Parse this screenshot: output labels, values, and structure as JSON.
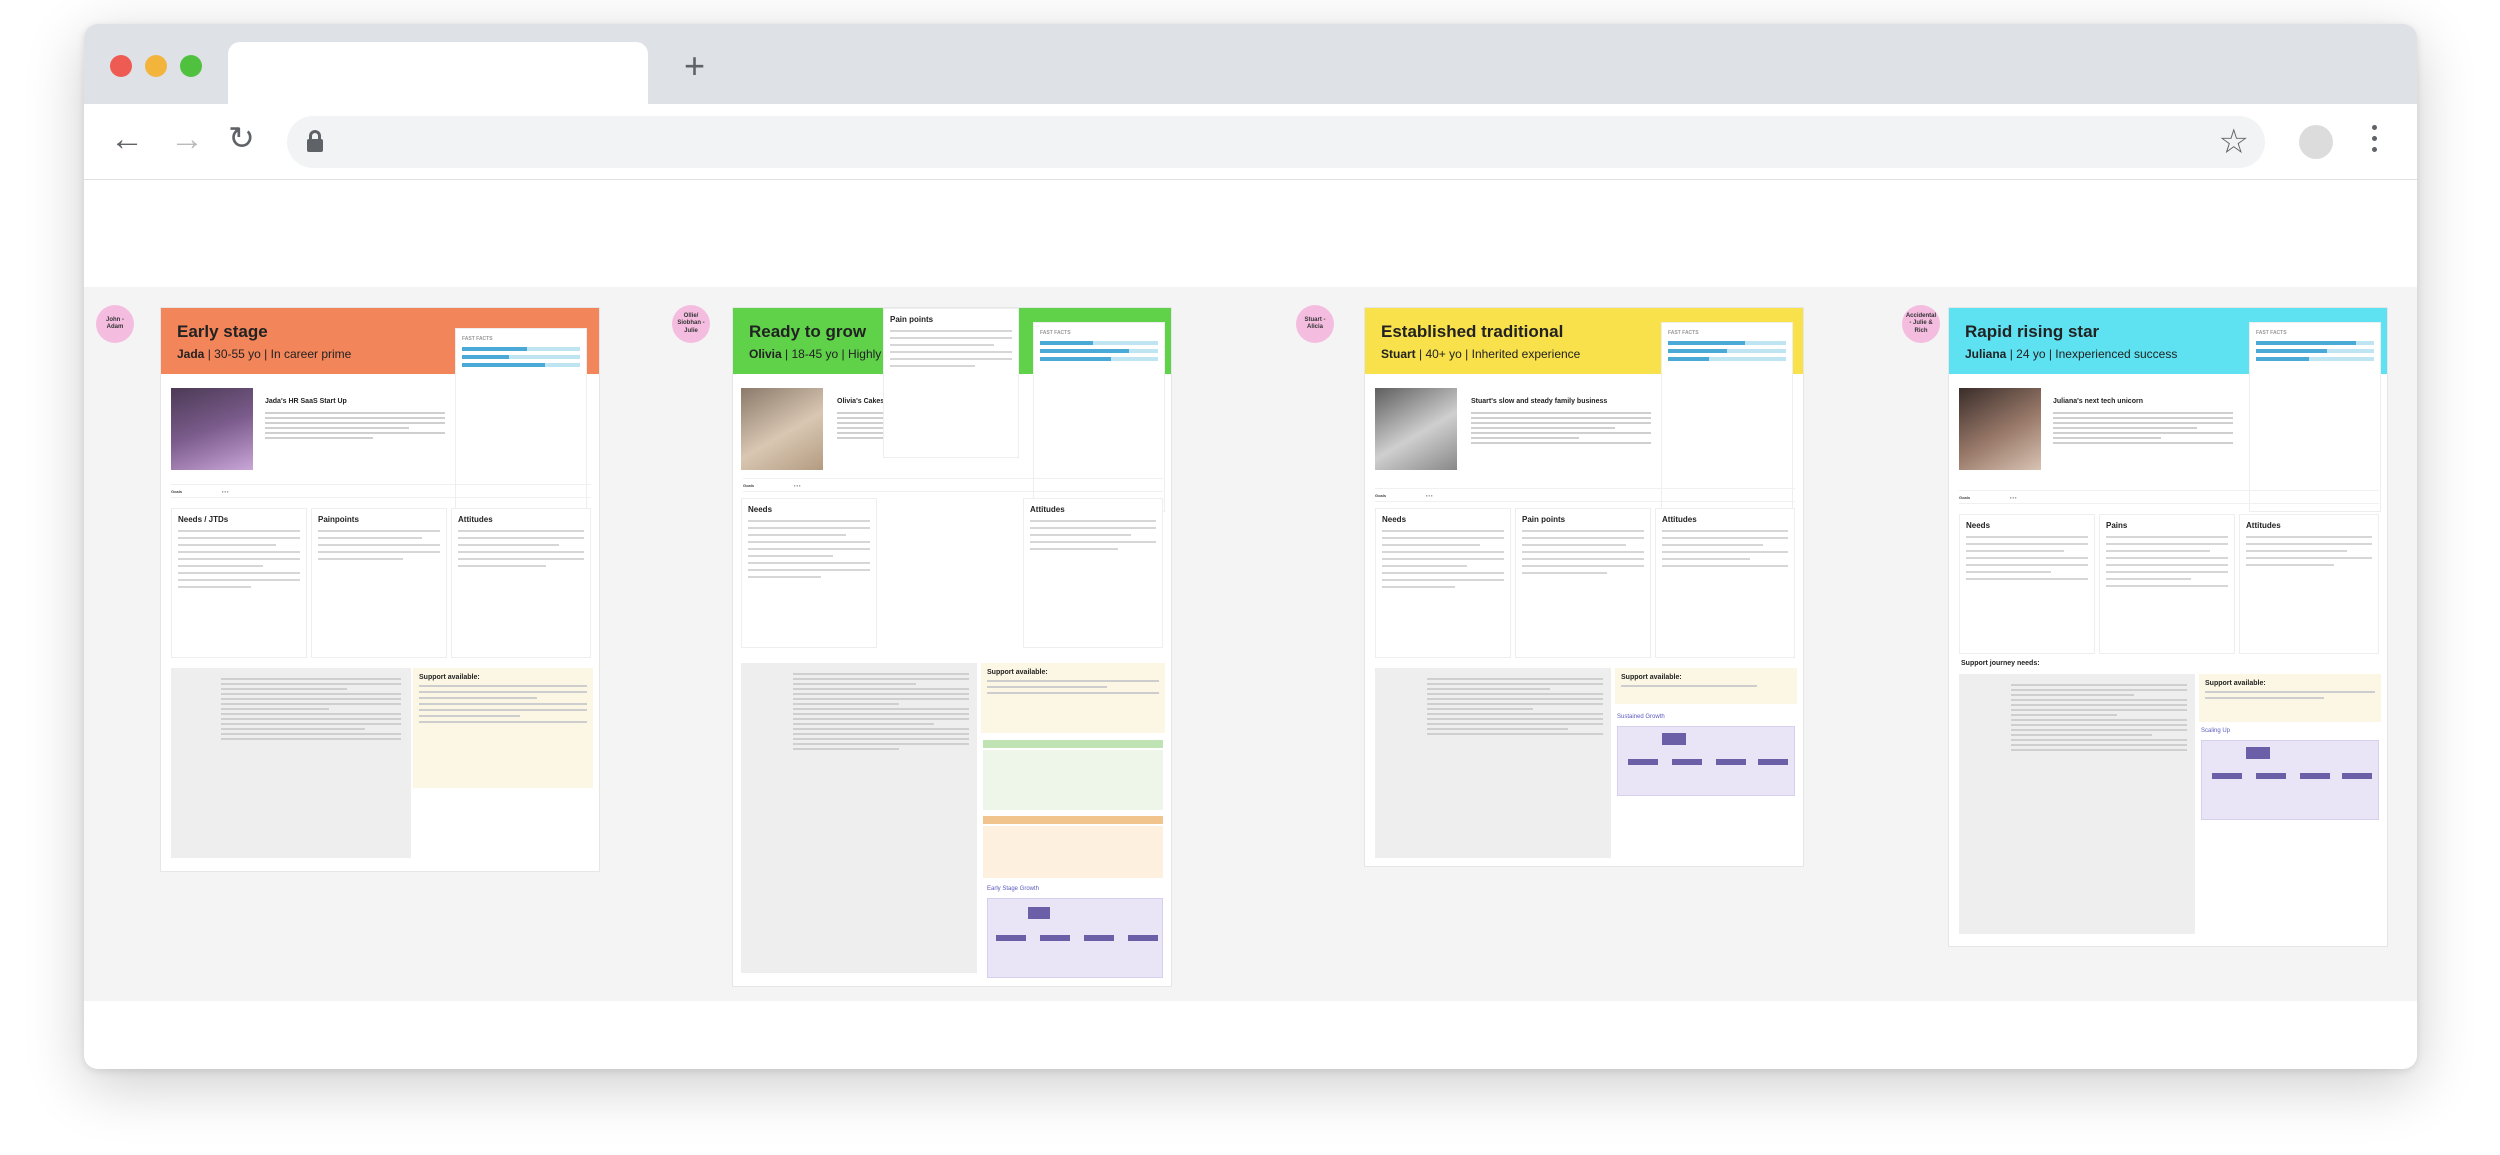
{
  "browser": {
    "new_tab_icon": "plus-icon",
    "nav_icons": [
      "back-arrow-icon",
      "forward-arrow-icon",
      "reload-icon"
    ],
    "address_icon": "lock-icon",
    "bookmark_icon": "star-icon",
    "menu_icon": "kebab-menu-icon"
  },
  "colors": {
    "early": "#f2855a",
    "ready": "#5fd24a",
    "established": "#f8e14b",
    "rapid": "#5ee2f2",
    "avatar": "#f4bde0"
  },
  "personas": [
    {
      "avatar": "John - Adam",
      "title": "Early stage",
      "name": "Jada",
      "subtitle": " | 30-55 yo | In career prime",
      "case_title": "Jada's HR SaaS Start Up",
      "goals_label": "Goals",
      "sections": [
        "Needs / JTDs",
        "Painpoints",
        "Attitudes"
      ],
      "support": "Support available:"
    },
    {
      "avatar": "Ollie/ Siobhan - Julie",
      "title": "Ready to grow",
      "name": "Olivia",
      "subtitle": " | 18-45 yo | Highly educated & confident",
      "case_title": "Olivia's Cakes Instagram Boom",
      "goals_label": "Goals",
      "sections": [
        "Needs",
        "Pain points",
        "Attitudes"
      ],
      "support": "Support available:",
      "growth_label": "Early Stage Growth"
    },
    {
      "avatar": "Stuart - Alicia",
      "title": "Established traditional",
      "name": "Stuart",
      "subtitle": " | 40+ yo | Inherited experience",
      "case_title": "Stuart's slow and steady family business",
      "goals_label": "Goals",
      "sections": [
        "Needs",
        "Pain points",
        "Attitudes"
      ],
      "support": "Support available:",
      "growth_label": "Sustained Growth"
    },
    {
      "avatar": "Accidental - Julie & Rich",
      "title": "Rapid rising star",
      "name": "Juliana",
      "subtitle": " | 24 yo | Inexperienced success",
      "case_title": "Juliana's next tech unicorn",
      "goals_label": "Goals",
      "sections": [
        "Needs",
        "Pains",
        "Attitudes"
      ],
      "support": "Support available:",
      "journey": "Support journey needs:",
      "growth_label": "Scaling Up"
    }
  ]
}
